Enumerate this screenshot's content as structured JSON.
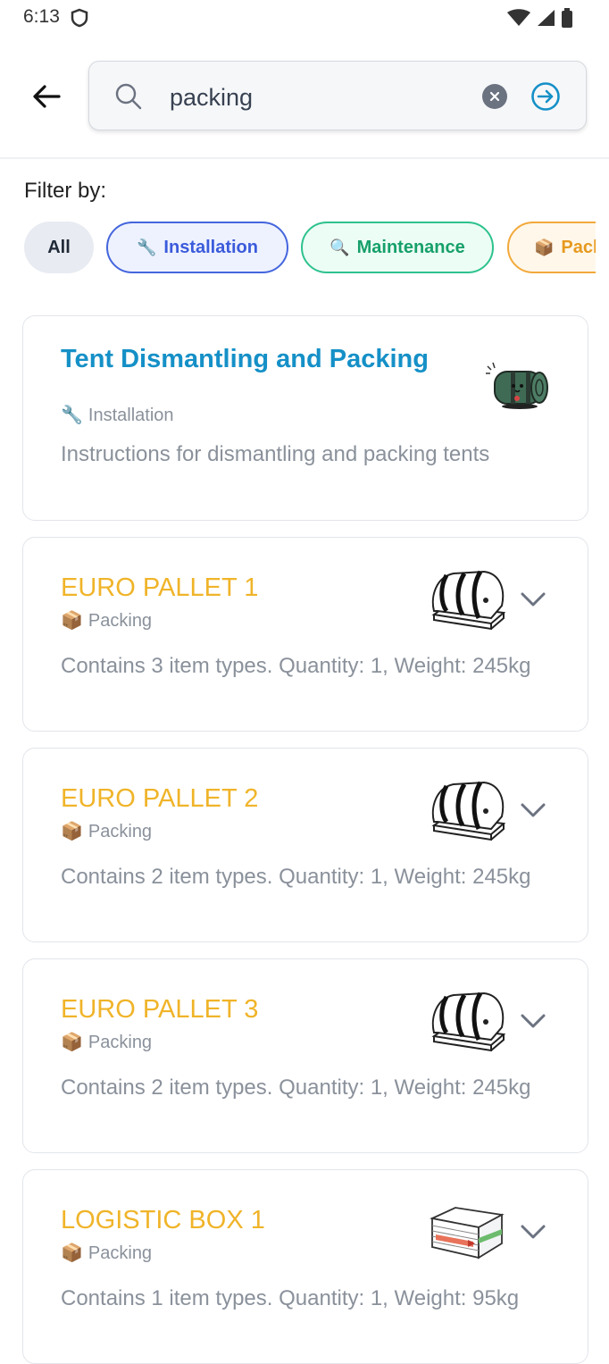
{
  "status": {
    "time": "6:13"
  },
  "search": {
    "query": "packing"
  },
  "filter": {
    "label": "Filter by:",
    "chips": [
      {
        "label": "All",
        "emoji": ""
      },
      {
        "label": "Installation",
        "emoji": "🔧"
      },
      {
        "label": "Maintenance",
        "emoji": "🔍"
      },
      {
        "label": "Packing",
        "emoji": "📦"
      }
    ]
  },
  "colors": {
    "tent_title": "#1590c7",
    "pallet_title": "#f0b429",
    "installation": "#3b5bdb",
    "maintenance": "#16a06a",
    "packing": "#e69a1f"
  },
  "results": [
    {
      "title": "Tent Dismantling and Packing",
      "category": "Installation",
      "category_emoji": "🔧",
      "description": "Instructions for dismantling and packing tents",
      "image": "rolled-tent-icon"
    },
    {
      "title": "EURO PALLET 1",
      "category": "Packing",
      "category_emoji": "📦",
      "description": "Contains 3 item types. Quantity: 1, Weight: 245kg",
      "image": "euro-pallet-icon"
    },
    {
      "title": "EURO PALLET 2",
      "category": "Packing",
      "category_emoji": "📦",
      "description": "Contains 2 item types. Quantity: 1, Weight: 245kg",
      "image": "euro-pallet-icon"
    },
    {
      "title": "EURO PALLET 3",
      "category": "Packing",
      "category_emoji": "📦",
      "description": "Contains 2 item types. Quantity: 1, Weight: 245kg",
      "image": "euro-pallet-icon"
    },
    {
      "title": "LOGISTIC BOX 1",
      "category": "Packing",
      "category_emoji": "📦",
      "description": "Contains 1 item types. Quantity: 1, Weight: 95kg",
      "image": "logistic-box-icon"
    }
  ]
}
